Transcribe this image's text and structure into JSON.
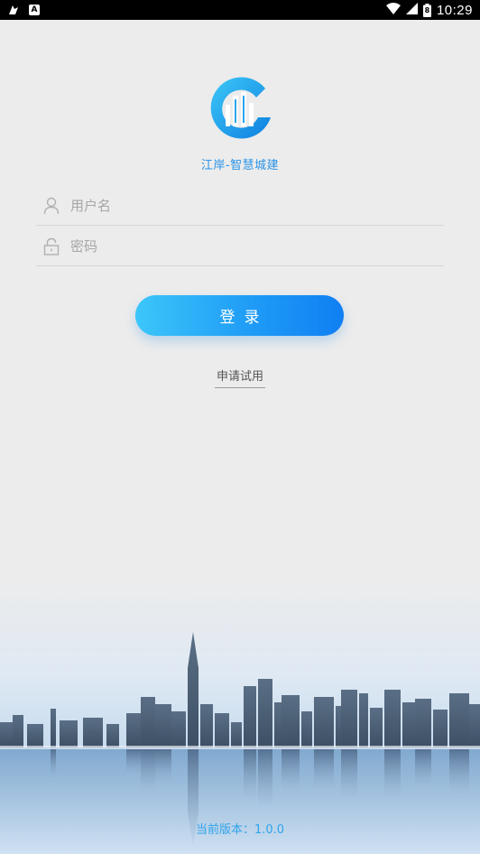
{
  "status_bar": {
    "time": "10:29",
    "battery_level": "8",
    "icons": [
      "app-notification-icon",
      "a-notification-icon",
      "wifi-icon",
      "signal-icon",
      "battery-icon"
    ],
    "notif_a_letter": "A"
  },
  "app": {
    "name": "江岸-智慧城建",
    "logo_icon": "city-building-logo-icon",
    "brand_color": "#2a93e8"
  },
  "form": {
    "username": {
      "placeholder": "用户名",
      "value": "",
      "icon": "user-icon"
    },
    "password": {
      "placeholder": "密码",
      "value": "",
      "icon": "lock-icon"
    }
  },
  "login_button": {
    "label": "登录"
  },
  "apply_trial": {
    "label": "申请试用"
  },
  "footer": {
    "version_text": "当前版本：1.0.0"
  }
}
